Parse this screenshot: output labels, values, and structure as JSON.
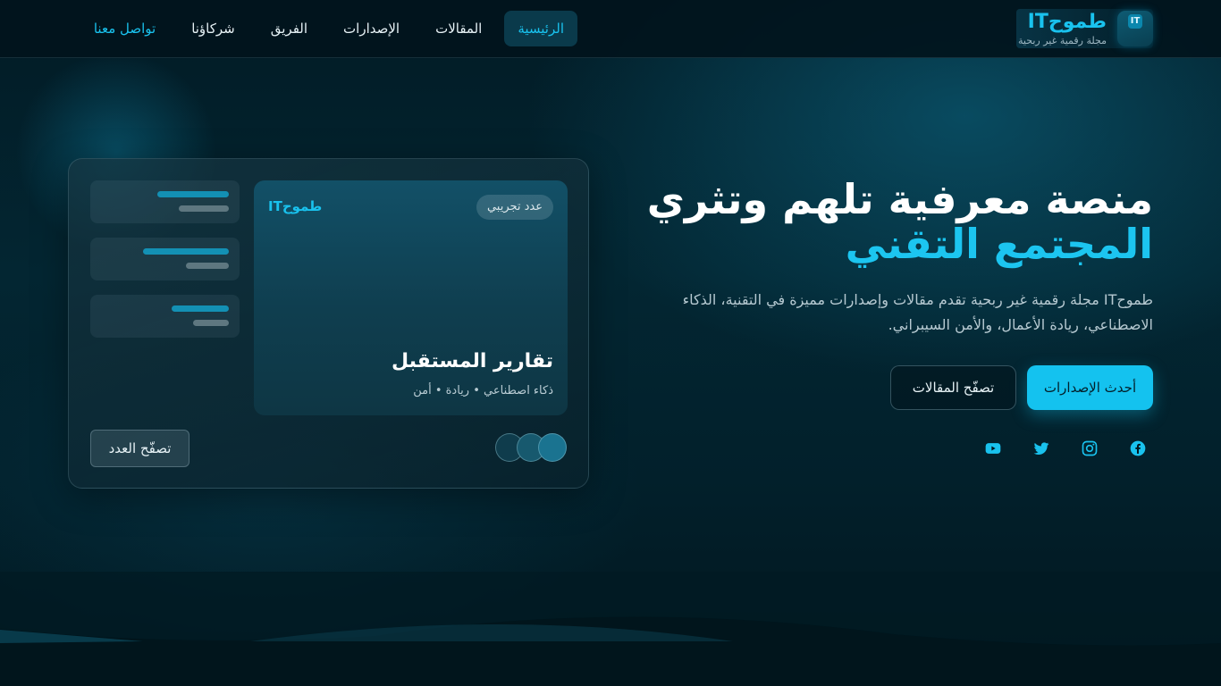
{
  "brand": {
    "name": "طموحIT",
    "tagline": "مجلة رقمية غير ربحية",
    "badge_text": "IT"
  },
  "nav": {
    "items": [
      {
        "label": "الرئيسية",
        "active": true
      },
      {
        "label": "المقالات",
        "active": false
      },
      {
        "label": "الإصدارات",
        "active": false
      },
      {
        "label": "الفريق",
        "active": false
      },
      {
        "label": "شركاؤنا",
        "active": false
      },
      {
        "label": "تواصل معنا",
        "active": false
      }
    ]
  },
  "hero": {
    "title_line1": "منصة معرفية تلهم وتثري",
    "title_line2": "المجتمع التقني",
    "description": "طموحIT مجلة رقمية غير ربحية تقدم مقالات وإصدارات مميزة في التقنية، الذكاء الاصطناعي، ريادة الأعمال، والأمن السيبراني.",
    "primary_button": "أحدث الإصدارات",
    "secondary_button": "تصفّح المقالات"
  },
  "socials": [
    {
      "icon": "facebook-icon"
    },
    {
      "icon": "instagram-icon"
    },
    {
      "icon": "twitter-icon"
    },
    {
      "icon": "youtube-icon"
    }
  ],
  "issue_card": {
    "brand": "طموحIT",
    "badge": "عدد تجريبي",
    "title": "تقارير المستقبل",
    "subtitle": "ذكاء اصطناعي • ريادة • أمن",
    "browse_button": "تصفّح العدد"
  },
  "colors": {
    "accent": "#14c2ef",
    "background": "#01161e",
    "nav_active_bg": "#0a3a4b"
  }
}
